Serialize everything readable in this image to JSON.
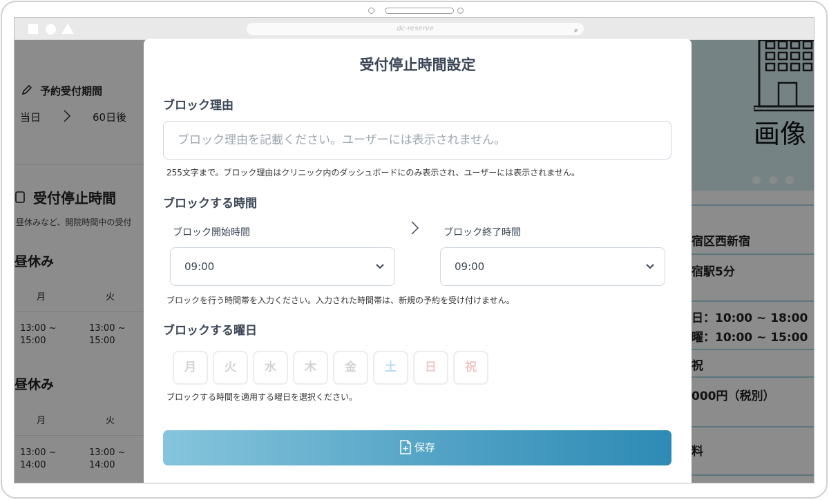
{
  "browser": {
    "url": "dc-reserve"
  },
  "background": {
    "left": {
      "period_title": "予約受付期間",
      "period_from": "当日",
      "period_to": "60日後",
      "stop_title": "受付停止時間",
      "stop_desc": "昼休みなど、開院時間中の受付",
      "group1": {
        "title": "昼休み",
        "col1": "月",
        "col2": "火",
        "cell1": "13:00 ~\n15:00",
        "cell2": "13:00 ~\n15:00"
      },
      "group2": {
        "title": "昼休み",
        "col1": "月",
        "col2": "火",
        "cell1": "13:00 ~\n14:00",
        "cell2": "13:00 ~\n14:00"
      }
    },
    "right": {
      "hero_text": "画像",
      "address": "宿区西新宿",
      "station": "宿駅5分",
      "hours1": "日：10:00 ~ 18:00",
      "hours2": "曜：10:00 ~ 15:00",
      "holiday": "祝",
      "price": "000円（税別）",
      "fee": "料"
    }
  },
  "modal": {
    "title": "受付停止時間設定",
    "reason_label": "ブロック理由",
    "reason_placeholder": "ブロック理由を記載ください。ユーザーには表示されません。",
    "reason_hint": "255文字まで。ブロック理由はクリニック内のダッシュボードにのみ表示され、ユーザーには表示されません。",
    "time_label": "ブロックする時間",
    "start_label": "ブロック開始時間",
    "start_value": "09:00",
    "end_label": "ブロック終了時間",
    "end_value": "09:00",
    "time_hint": "ブロックを行う時間帯を入力ください。入力された時間帯は、新規の予約を受け付けません。",
    "days_label": "ブロックする曜日",
    "days": [
      "月",
      "火",
      "水",
      "木",
      "金",
      "土",
      "日",
      "祝"
    ],
    "days_hint": "ブロックする時間を適用する曜日を選択ください。",
    "save_label": "保存"
  }
}
